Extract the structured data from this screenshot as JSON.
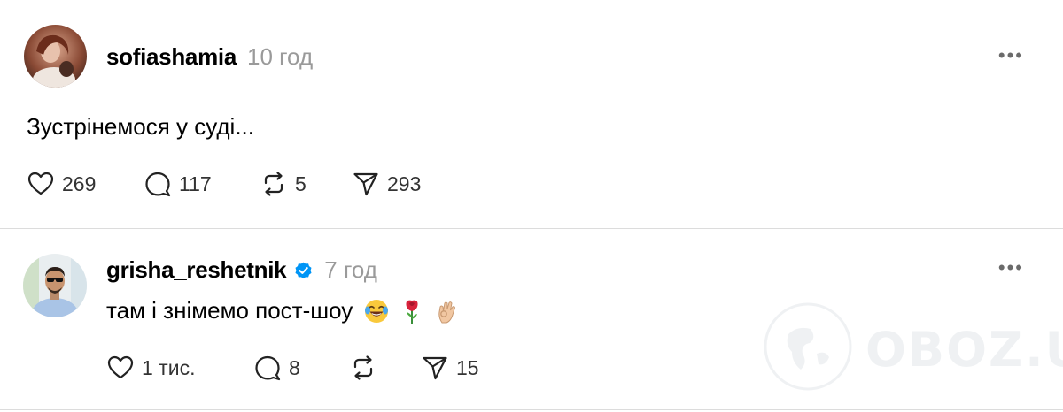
{
  "posts": [
    {
      "username": "sofiashamia",
      "time": "10 год",
      "text": "Зустрінемося у суді...",
      "more_label": "•••",
      "actions": {
        "likes": "269",
        "comments": "117",
        "reposts": "5",
        "shares": "293"
      }
    },
    {
      "username": "grisha_reshetnik",
      "verified": true,
      "time": "7 год",
      "text": "там і знімемо пост-шоу",
      "emojis": [
        "face-with-tears-of-joy",
        "rose",
        "ok-hand"
      ],
      "more_label": "•••",
      "actions": {
        "likes": "1 тис.",
        "comments": "8",
        "reposts": "",
        "shares": "15"
      }
    }
  ],
  "watermark": {
    "text": "OBOZ.UA"
  },
  "colors": {
    "verified_blue": "#0095f6",
    "muted_text": "#9a9a9a",
    "divider": "#dcdcdc"
  }
}
